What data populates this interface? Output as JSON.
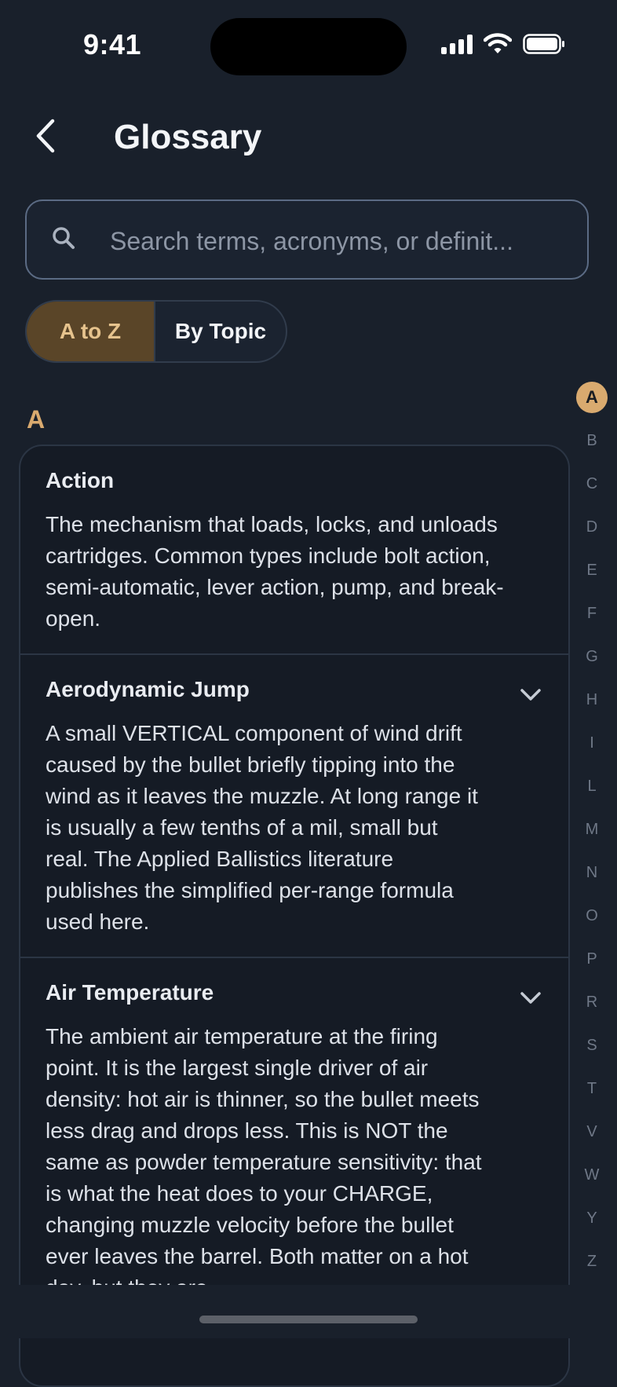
{
  "status_bar": {
    "time": "9:41"
  },
  "header": {
    "title": "Glossary"
  },
  "search": {
    "placeholder": "Search terms, acronyms, or definit..."
  },
  "segments": {
    "a_to_z": "A to Z",
    "by_topic": "By Topic"
  },
  "section": {
    "letter": "A"
  },
  "entries": [
    {
      "term": "Action",
      "definition": "The mechanism that loads, locks, and unloads cartridges. Common types include bolt action, semi-automatic, lever action, pump, and break-open."
    },
    {
      "term": "Aerodynamic Jump",
      "definition": "A small VERTICAL component of wind drift caused by the bullet briefly tipping into the wind as it leaves the muzzle. At long range it is usually a few tenths of a mil, small but real. The Applied Ballistics literature publishes the simplified per-range formula used here."
    },
    {
      "term": "Air Temperature",
      "definition": "The ambient air temperature at the firing point. It is the largest single driver of air density: hot air is thinner, so the bullet meets less drag and drops less. This is NOT the same as powder temperature sensitivity: that is what the heat does to your CHARGE, changing muzzle velocity before the bullet ever leaves the barrel. Both matter on a hot day, but they are"
    }
  ],
  "index_letters": [
    "A",
    "B",
    "C",
    "D",
    "E",
    "F",
    "G",
    "H",
    "I",
    "L",
    "M",
    "N",
    "O",
    "P",
    "R",
    "S",
    "T",
    "V",
    "W",
    "Y",
    "Z"
  ],
  "active_letter": "A",
  "colors": {
    "accent": "#d9aa6f",
    "background": "#19202b",
    "segment_active": "#5a4528"
  }
}
